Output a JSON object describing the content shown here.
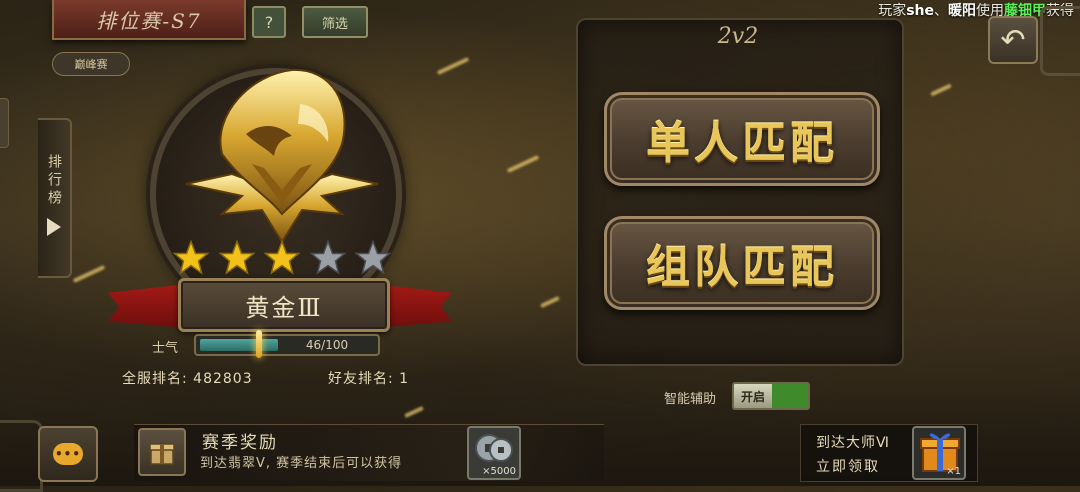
{
  "header": {
    "season_title": "排位赛-S7",
    "help_label": "?",
    "filter_label": "筛选",
    "tier_chip": "巅峰赛"
  },
  "broadcast": {
    "prefix": "玩家",
    "player": "she",
    "sep": "、",
    "player2": "暖阳",
    "mid": "使用",
    "item": "藤钿甲",
    "suffix": "获得"
  },
  "leaderboard": {
    "label": "排行榜"
  },
  "rank": {
    "name": "黄金Ⅲ",
    "stars_total": 5,
    "stars_filled": 3,
    "star_colors": {
      "filled": "#f2c21a",
      "empty": "#9aa0a6"
    }
  },
  "morale": {
    "label": "士气",
    "current": 46,
    "max": 100,
    "text": "46/100"
  },
  "ranking": {
    "server_rank": "全服排名: 482803",
    "friend_rank": "好友排名: 1"
  },
  "modes": {
    "title": "2v2",
    "solo_label": "单人匹配",
    "team_label": "组队匹配"
  },
  "assist": {
    "label": "智能辅助",
    "toggle_label": "开启",
    "toggle_color": "#3f8a2a"
  },
  "reward": {
    "title": "赛季奖励",
    "description": "到达翡翠Ⅴ, 赛季结束后可以获得",
    "coin_qty": "×5000"
  },
  "master": {
    "line1": "到达大师Ⅵ",
    "line2": "立即领取",
    "gift_qty": "×1"
  },
  "chat": {
    "label": "•••"
  },
  "back": {
    "icon": "back-arrow-icon"
  }
}
